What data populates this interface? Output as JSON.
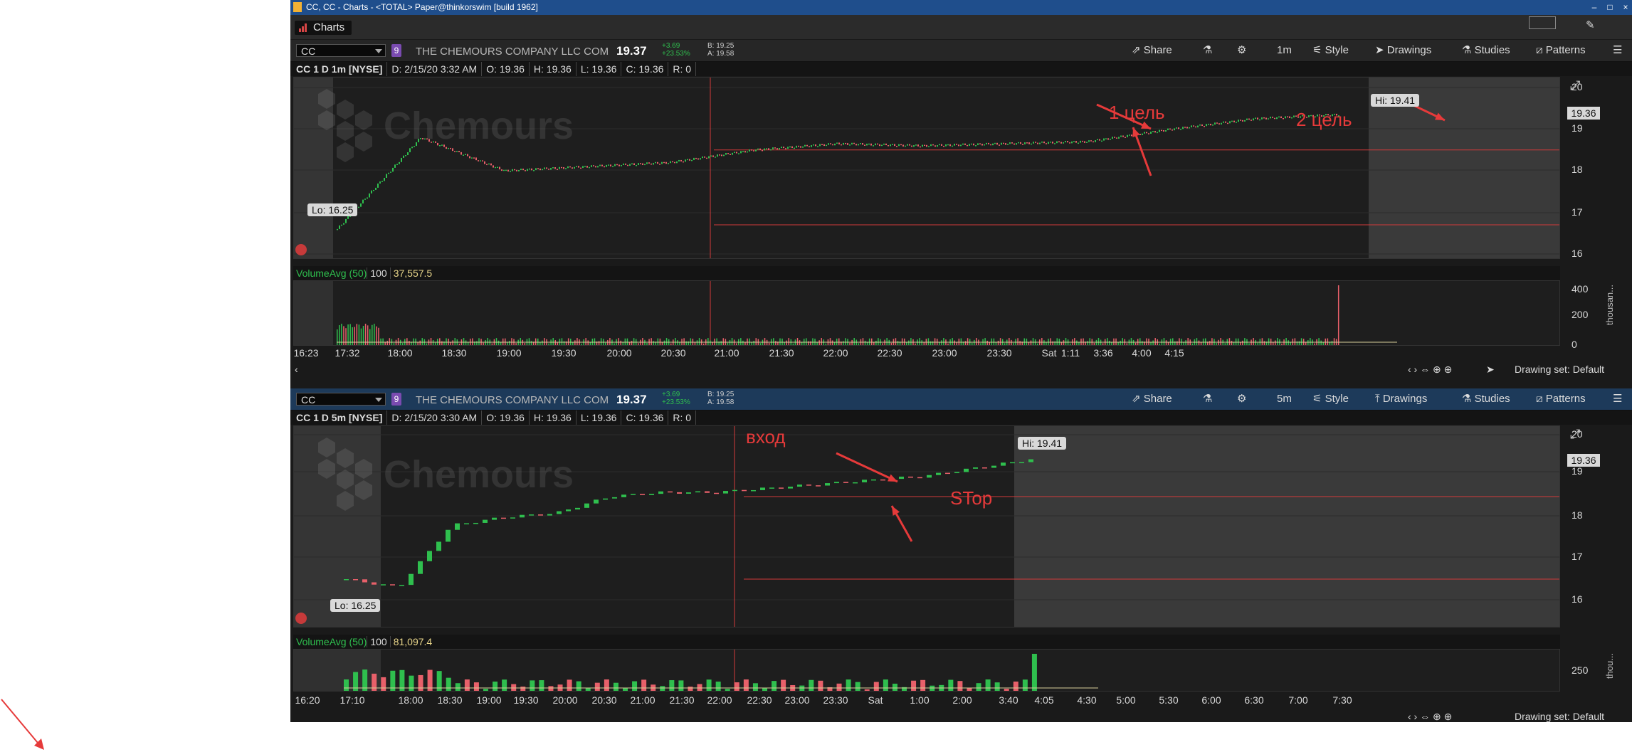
{
  "window": {
    "title": "CC, CC - Charts - <TOTAL> Paper@thinkorswim [build 1962]"
  },
  "tab": {
    "label": "Charts"
  },
  "panels": [
    {
      "symbol": "CC",
      "company": "THE CHEMOURS COMPANY LLC COM",
      "price": "19.37",
      "change": "+3.69",
      "change_pct": "+23.53%",
      "bid": "B: 19.25",
      "ask": "A: 19.58",
      "toolbar": {
        "share": "Share",
        "interval": "1m",
        "style": "Style",
        "drawings": "Drawings",
        "studies": "Studies",
        "patterns": "Patterns"
      },
      "info": {
        "title": "CC 1 D 1m [NYSE]",
        "date": "D: 2/15/20 3:32 AM",
        "open": "O: 19.36",
        "high": "H: 19.36",
        "low": "L: 19.36",
        "close": "C: 19.36",
        "range": "R: 0"
      },
      "watermark": "Chemours",
      "price_tag": "19.36",
      "hi_label": "Hi: 19.41",
      "lo_label": "Lo: 16.25",
      "y_ticks": [
        "20",
        "19",
        "18",
        "17",
        "16"
      ],
      "volume": {
        "study": "VolumeAvg (50)",
        "setting": "100",
        "value": "37,557.5",
        "y_ticks": [
          "400",
          "200",
          "0"
        ],
        "unit": "thousan..."
      },
      "x_ticks": [
        "16:23",
        "17:32",
        "18:00",
        "18:30",
        "19:00",
        "19:30",
        "20:00",
        "20:30",
        "21:00",
        "21:30",
        "22:00",
        "22:30",
        "23:00",
        "23:30",
        "Sat",
        "1:11",
        "3:36",
        "4:00",
        "4:15"
      ],
      "annotations": [
        "1 цель",
        "2 цель"
      ],
      "drawing_set": "Drawing set: Default"
    },
    {
      "symbol": "CC",
      "company": "THE CHEMOURS COMPANY LLC COM",
      "price": "19.37",
      "change": "+3.69",
      "change_pct": "+23.53%",
      "bid": "B: 19.25",
      "ask": "A: 19.58",
      "toolbar": {
        "share": "Share",
        "interval": "5m",
        "style": "Style",
        "drawings": "Drawings",
        "studies": "Studies",
        "patterns": "Patterns"
      },
      "info": {
        "title": "CC 1 D 5m [NYSE]",
        "date": "D: 2/15/20 3:30 AM",
        "open": "O: 19.36",
        "high": "H: 19.36",
        "low": "L: 19.36",
        "close": "C: 19.36",
        "range": "R: 0"
      },
      "watermark": "Chemours",
      "price_tag": "19.36",
      "hi_label": "Hi: 19.41",
      "lo_label": "Lo: 16.25",
      "y_ticks": [
        "20",
        "19",
        "18",
        "17",
        "16"
      ],
      "volume": {
        "study": "VolumeAvg (50)",
        "setting": "100",
        "value": "81,097.4",
        "y_ticks": [
          "250"
        ],
        "unit": "thou..."
      },
      "x_ticks": [
        "16:20",
        "17:10",
        "18:00",
        "18:30",
        "19:00",
        "19:30",
        "20:00",
        "20:30",
        "21:00",
        "21:30",
        "22:00",
        "22:30",
        "23:00",
        "23:30",
        "Sat",
        "1:00",
        "2:00",
        "3:40",
        "4:05",
        "4:30",
        "5:00",
        "5:30",
        "6:00",
        "6:30",
        "7:00",
        "7:30"
      ],
      "annotations": [
        "вход",
        "STop"
      ],
      "drawing_set": "Drawing set: Default"
    }
  ],
  "colors": {
    "up": "#2fbf4e",
    "down": "#e8606a",
    "annotation": "#e63a3a",
    "background": "#1e1e1e"
  },
  "chart_data": [
    {
      "type": "line",
      "title": "CC 1 D 1m [NYSE]",
      "x": [
        "17:32",
        "18:00",
        "18:30",
        "19:00",
        "19:30",
        "20:00",
        "20:30",
        "21:00",
        "21:30",
        "22:00",
        "22:30",
        "23:00",
        "23:30"
      ],
      "series": [
        {
          "values": [
            16.6,
            18.8,
            18.0,
            18.1,
            18.2,
            18.5,
            18.65,
            18.6,
            18.65,
            18.7,
            19.0,
            19.25,
            19.35
          ]
        }
      ],
      "ylim": [
        15.8,
        20.2
      ],
      "hi": 19.41,
      "lo": 16.25
    },
    {
      "type": "line",
      "title": "CC 1 D 5m [NYSE]",
      "x": [
        "16:20",
        "17:10",
        "18:00",
        "18:30",
        "19:00",
        "19:30",
        "20:00",
        "20:30",
        "21:00",
        "21:30",
        "22:00",
        "22:30",
        "23:00",
        "23:30"
      ],
      "series": [
        {
          "values": [
            16.5,
            16.3,
            17.8,
            18.0,
            18.1,
            18.5,
            18.6,
            18.6,
            18.7,
            18.8,
            18.9,
            19.0,
            19.2,
            19.4
          ]
        }
      ],
      "ylim": [
        15.8,
        20.2
      ],
      "hi": 19.41,
      "lo": 16.25
    }
  ]
}
